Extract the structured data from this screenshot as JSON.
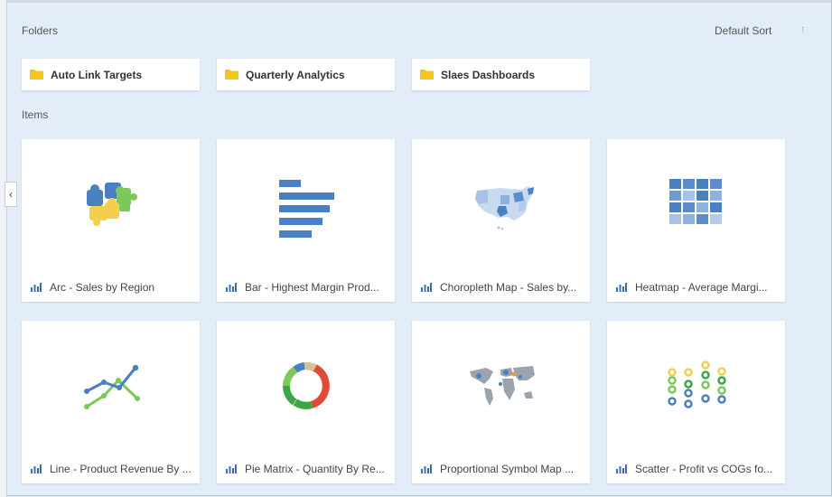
{
  "header": {
    "folders_label": "Folders",
    "sort_label": "Default Sort",
    "sort_arrow": "↑"
  },
  "folders": [
    {
      "name": "Auto Link Targets"
    },
    {
      "name": "Quarterly Analytics"
    },
    {
      "name": "Slaes Dashboards"
    }
  ],
  "items_label": "Items",
  "items": [
    {
      "title": "Arc - Sales by Region",
      "icon": "puzzle-icon"
    },
    {
      "title": "Bar - Highest Margin Prod...",
      "icon": "bar-chart-icon"
    },
    {
      "title": "Choropleth Map - Sales by...",
      "icon": "us-map-icon"
    },
    {
      "title": "Heatmap - Average Margi...",
      "icon": "heatmap-icon"
    },
    {
      "title": "Line - Product Revenue By ...",
      "icon": "line-chart-icon"
    },
    {
      "title": "Pie Matrix - Quantity By Re...",
      "icon": "donut-chart-icon"
    },
    {
      "title": "Proportional Symbol Map ...",
      "icon": "world-map-icon"
    },
    {
      "title": "Scatter - Profit vs COGs fo...",
      "icon": "scatter-chart-icon"
    }
  ],
  "collapse_glyph": "‹",
  "colors": {
    "background": "#e3edf9",
    "folder": "#f5c518",
    "accent_blue": "#4a7fc1",
    "green": "#7cc85a",
    "yellow": "#f4cf4e",
    "red": "#e04b36",
    "tan": "#d9c09a"
  }
}
